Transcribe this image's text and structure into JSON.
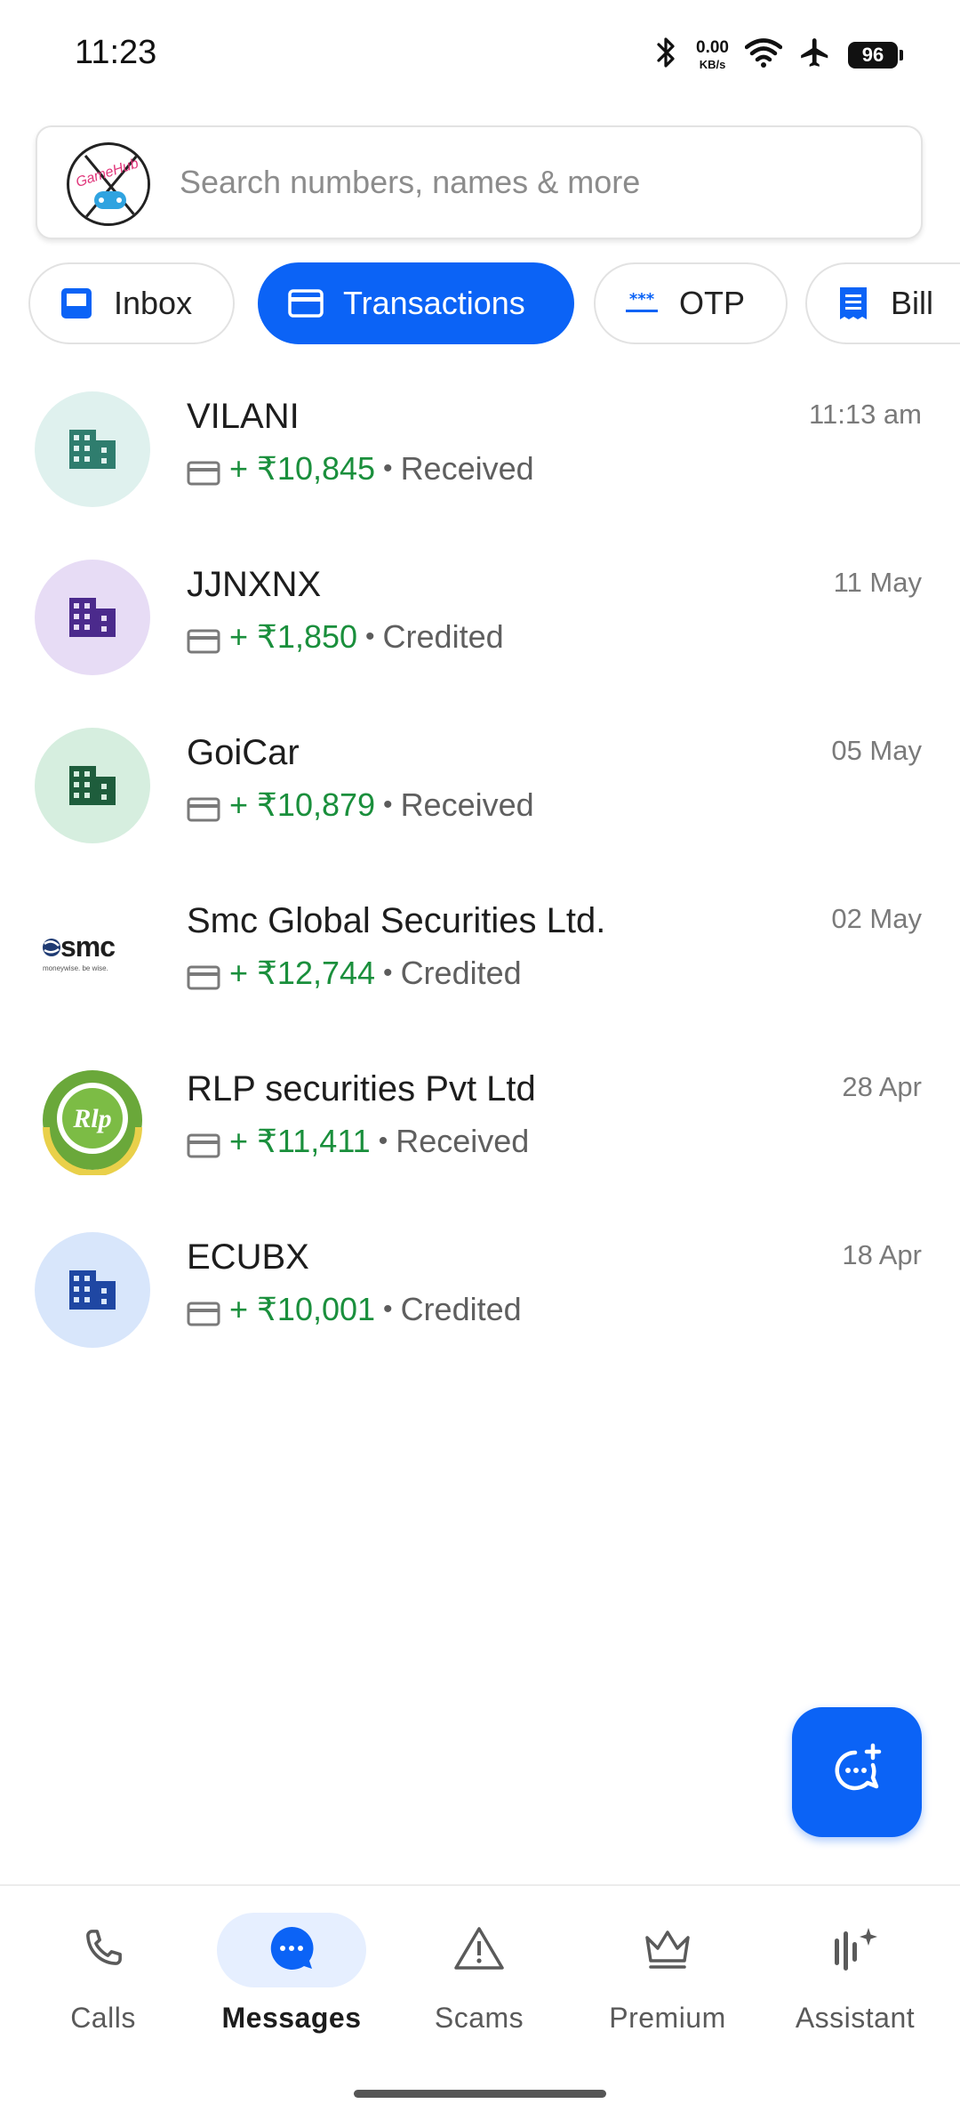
{
  "status_bar": {
    "time": "11:23",
    "speed_value": "0.00",
    "speed_unit": "KB/s",
    "battery": "96",
    "icons": [
      "bluetooth-icon",
      "wifi-icon",
      "airplane-icon",
      "battery-icon"
    ]
  },
  "search": {
    "placeholder": "Search numbers, names & more",
    "avatar_text": "GameHub"
  },
  "chips": [
    {
      "label": "Inbox",
      "icon": "inbox-icon",
      "active": false
    },
    {
      "label": "Transactions",
      "icon": "card-icon",
      "active": true
    },
    {
      "label": "OTP",
      "icon": "otp-icon",
      "active": false
    },
    {
      "label": "Bill",
      "icon": "bill-icon",
      "active": false
    }
  ],
  "transactions": [
    {
      "name": "VILANI",
      "time": "11:13 am",
      "amount": "+ ₹10,845",
      "status": "Received",
      "avatar": "building-icon",
      "avatar_bg": "#dff1ee",
      "avatar_fg": "#2f7d6e"
    },
    {
      "name": "JJNXNX",
      "time": "11 May",
      "amount": "+ ₹1,850",
      "status": "Credited",
      "avatar": "building-icon",
      "avatar_bg": "#e7dcf5",
      "avatar_fg": "#4b2a8c"
    },
    {
      "name": "GoiCar",
      "time": "05 May",
      "amount": "+ ₹10,879",
      "status": "Received",
      "avatar": "building-icon",
      "avatar_bg": "#d6eedf",
      "avatar_fg": "#1e5d3c"
    },
    {
      "name": "Smc Global Securities Ltd.",
      "time": "02 May",
      "amount": "+ ₹12,744",
      "status": "Credited",
      "avatar": "smc-logo",
      "logo_text": "smc",
      "logo_tagline": "moneywise. be wise."
    },
    {
      "name": "RLP securities Pvt Ltd",
      "time": "28 Apr",
      "amount": "+ ₹11,411",
      "status": "Received",
      "avatar": "rlp-logo",
      "logo_text": "Rlp"
    },
    {
      "name": "ECUBX",
      "time": "18 Apr",
      "amount": "+ ₹10,001",
      "status": "Credited",
      "avatar": "building-icon",
      "avatar_bg": "#d8e6fb",
      "avatar_fg": "#1f47a3"
    }
  ],
  "fab": {
    "icon": "new-message-icon"
  },
  "bottom_nav": [
    {
      "label": "Calls",
      "icon": "phone-icon",
      "active": false
    },
    {
      "label": "Messages",
      "icon": "chat-bubble-icon",
      "active": true
    },
    {
      "label": "Scams",
      "icon": "warning-icon",
      "active": false
    },
    {
      "label": "Premium",
      "icon": "crown-icon",
      "active": false
    },
    {
      "label": "Assistant",
      "icon": "assistant-icon",
      "active": false
    }
  ],
  "colors": {
    "accent": "#0b63f6",
    "amount_green": "#1a8f3c",
    "nav_active_bg": "#e6efff"
  }
}
